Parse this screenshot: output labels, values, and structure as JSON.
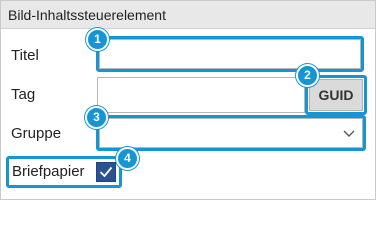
{
  "panel": {
    "title": "Bild-Inhaltssteuerelement"
  },
  "form": {
    "title_label": "Titel",
    "title_value": "",
    "tag_label": "Tag",
    "tag_value": "",
    "guid_button_label": "GUID",
    "group_label": "Gruppe",
    "group_value": "",
    "letterhead_label": "Briefpapier",
    "letterhead_checked": true
  },
  "callouts": [
    "1",
    "2",
    "3",
    "4"
  ],
  "icons": {
    "dropdown": "chevron-down-icon",
    "checkbox": "checkmark-icon"
  },
  "colors": {
    "highlight": "#1595d3",
    "checkbox_fill": "#2a5191",
    "header_bg": "#e8e8e8",
    "button_bg": "#dadada"
  }
}
